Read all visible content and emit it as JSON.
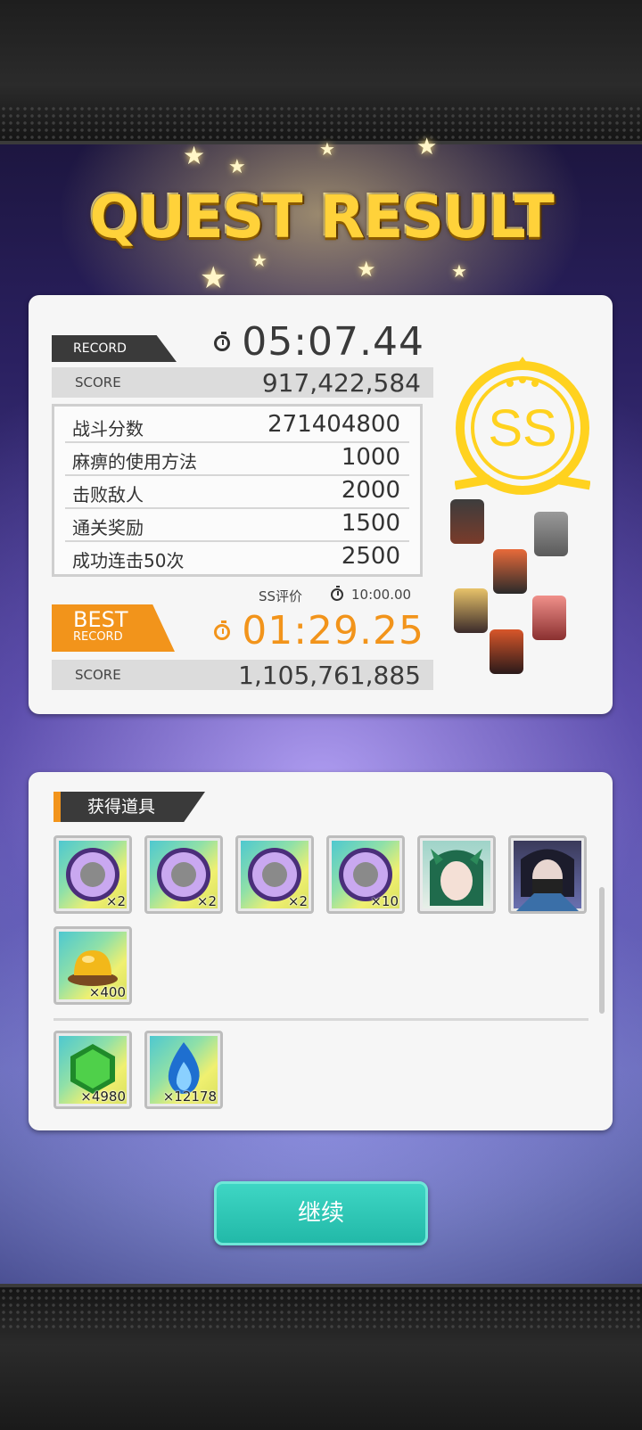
{
  "title": "QUEST RESULT",
  "record": {
    "tag": "RECORD",
    "time": "05:07.44",
    "score_label": "SCORE",
    "score": "917,422,584"
  },
  "breakdown": [
    {
      "label": "战斗分数",
      "value": "271404800"
    },
    {
      "label": "麻痹的使用方法",
      "value": "1000"
    },
    {
      "label": "击败敌人",
      "value": "2000"
    },
    {
      "label": "通关奖励",
      "value": "1500"
    },
    {
      "label": "成功连击50次",
      "value": "2500"
    }
  ],
  "ss_condition": {
    "label": "SS评价",
    "time": "10:00.00"
  },
  "best": {
    "tag_line1": "BEST",
    "tag_line2": "RECORD",
    "time": "01:29.25",
    "score_label": "SCORE",
    "score": "1,105,761,885"
  },
  "rank": "SS",
  "items_section": {
    "title": "获得道具",
    "items": [
      {
        "icon": "purple-medal-icon",
        "qty": "×2"
      },
      {
        "icon": "purple-medal-icon",
        "qty": "×2"
      },
      {
        "icon": "purple-medal-icon",
        "qty": "×2"
      },
      {
        "icon": "purple-medal-icon",
        "qty": "×10"
      },
      {
        "icon": "green-hair-character-portrait",
        "qty": ""
      },
      {
        "icon": "masked-character-portrait",
        "qty": ""
      },
      {
        "icon": "golden-pudding-icon",
        "qty": "×400"
      }
    ],
    "currency": [
      {
        "icon": "green-gem-icon",
        "qty": "×4980"
      },
      {
        "icon": "blue-flame-icon",
        "qty": "×12178"
      }
    ]
  },
  "continue_label": "继续",
  "colors": {
    "accent_orange": "#f2941b",
    "title_gold": "#ffd23a",
    "button_teal": "#2bc7b5",
    "dark_tag": "#3a3a3a"
  }
}
